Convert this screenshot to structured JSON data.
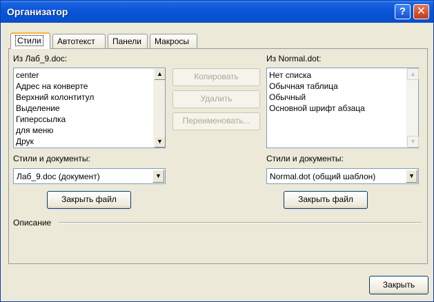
{
  "window": {
    "title": "Организатор",
    "help_glyph": "?",
    "close_glyph": "✕"
  },
  "tabs": [
    {
      "label": "Стили"
    },
    {
      "label": "Автотекст"
    },
    {
      "label": "Панели"
    },
    {
      "label": "Макросы"
    }
  ],
  "left": {
    "list_label": "Из Лаб_9.doc:",
    "items": [
      "center",
      "Адрес на конверте",
      "Верхний колонтитул",
      "Выделение",
      "Гиперссылка",
      "для меню",
      "Друк"
    ],
    "source_label": "Стили и документы:",
    "source_value": "Лаб_9.doc (документ)",
    "close_file": "Закрыть файл"
  },
  "right": {
    "list_label": "Из Normal.dot:",
    "items": [
      "Нет списка",
      "Обычная таблица",
      "Обычный",
      "Основной шрифт абзаца"
    ],
    "source_label": "Стили и документы:",
    "source_value": "Normal.dot (общий шаблон)",
    "close_file": "Закрыть файл"
  },
  "actions": {
    "copy": "Копировать",
    "delete": "Удалить",
    "rename": "Переименовать..."
  },
  "description_label": "Описание",
  "close_button": "Закрыть",
  "icons": {
    "scroll_up": "▲",
    "scroll_down": "▼",
    "combo": "▼"
  }
}
